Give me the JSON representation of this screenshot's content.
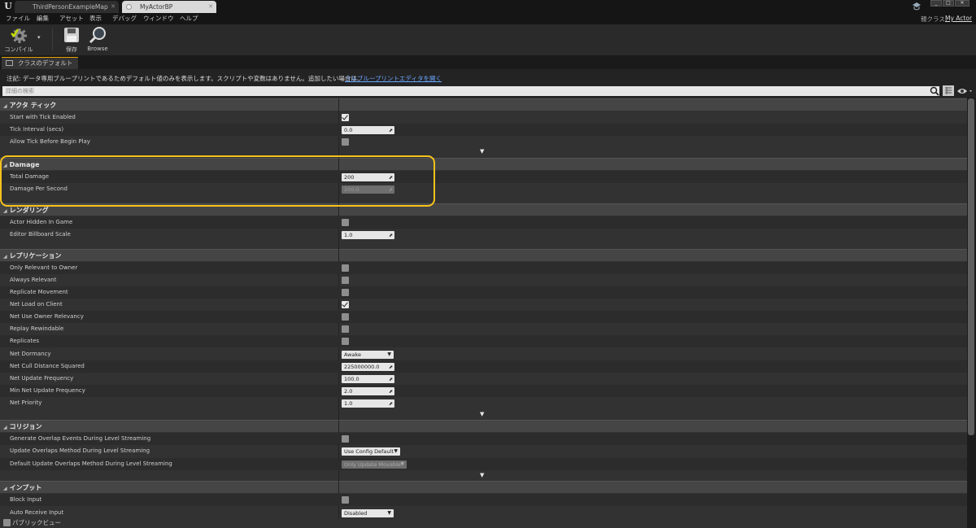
{
  "window": {
    "tabs": [
      "ThirdPersonExampleMap",
      "MyActorBP"
    ],
    "parent_class_label": "親クラス:",
    "parent_class_value": "My Actor"
  },
  "menu": [
    "ファイル",
    "編集",
    "アセット",
    "表示",
    "デバッグ",
    "ウィンドウ",
    "ヘルプ"
  ],
  "toolbar": {
    "compile": "コンパイル",
    "save": "保存",
    "browse": "Browse"
  },
  "panel_tab": "クラスのデフォルト",
  "notice": {
    "text": "注記:  データ専用ブループリントであるためデフォルト値のみを表示します。スクリプトや変数はありません。追加したい場合は、",
    "link": "フルブループリントエディタを開く"
  },
  "search": {
    "placeholder": "詳細の検索"
  },
  "categories": {
    "actor_tick": {
      "title": "アクタ ティック",
      "rows": {
        "start_with_tick": {
          "label": "Start with Tick Enabled",
          "checked": true
        },
        "tick_interval": {
          "label": "Tick Interval (secs)",
          "value": "0.0"
        },
        "allow_tick": {
          "label": "Allow Tick Before Begin Play",
          "checked": false
        }
      }
    },
    "damage": {
      "title": "Damage",
      "rows": {
        "total_damage": {
          "label": "Total Damage",
          "value": "200"
        },
        "damage_per_second": {
          "label": "Damage Per Second",
          "value": "200.0"
        }
      }
    },
    "rendering": {
      "title": "レンダリング",
      "rows": {
        "actor_hidden": {
          "label": "Actor Hidden In Game",
          "checked": false
        },
        "billboard_scale": {
          "label": "Editor Billboard Scale",
          "value": "1.0"
        }
      }
    },
    "replication": {
      "title": "レプリケーション",
      "rows": {
        "only_relevant": {
          "label": "Only Relevant to Owner",
          "checked": false
        },
        "always_relevant": {
          "label": "Always Relevant",
          "checked": false
        },
        "replicate_movement": {
          "label": "Replicate Movement",
          "checked": false
        },
        "net_load": {
          "label": "Net Load on Client",
          "checked": true
        },
        "net_use_owner": {
          "label": "Net Use Owner Relevancy",
          "checked": false
        },
        "replay_rewindable": {
          "label": "Replay Rewindable",
          "checked": false
        },
        "replicates": {
          "label": "Replicates",
          "checked": false
        },
        "net_dormancy": {
          "label": "Net Dormancy",
          "value": "Awake"
        },
        "net_cull": {
          "label": "Net Cull Distance Squared",
          "value": "225000000.0"
        },
        "net_update_freq": {
          "label": "Net Update Frequency",
          "value": "100.0"
        },
        "min_net_update": {
          "label": "Min Net Update Frequency",
          "value": "2.0"
        },
        "net_priority": {
          "label": "Net Priority",
          "value": "1.0"
        }
      }
    },
    "collision": {
      "title": "コリジョン",
      "rows": {
        "generate_overlap": {
          "label": "Generate Overlap Events During Level Streaming",
          "checked": false
        },
        "update_overlaps": {
          "label": "Update Overlaps Method During Level Streaming",
          "value": "Use Config Default"
        },
        "default_update_overlaps": {
          "label": "Default Update Overlaps Method During Level Streaming",
          "value": "Only Update Movable"
        }
      }
    },
    "input": {
      "title": "インプット",
      "rows": {
        "block_input": {
          "label": "Block Input",
          "checked": false
        },
        "auto_receive": {
          "label": "Auto Receive Input",
          "value": "Disabled"
        }
      }
    }
  },
  "public_view": "パブリックビュー",
  "colors": {
    "highlight": "#f6c21c",
    "link": "#6aa6ff",
    "tab_accent": "#e5a100"
  }
}
